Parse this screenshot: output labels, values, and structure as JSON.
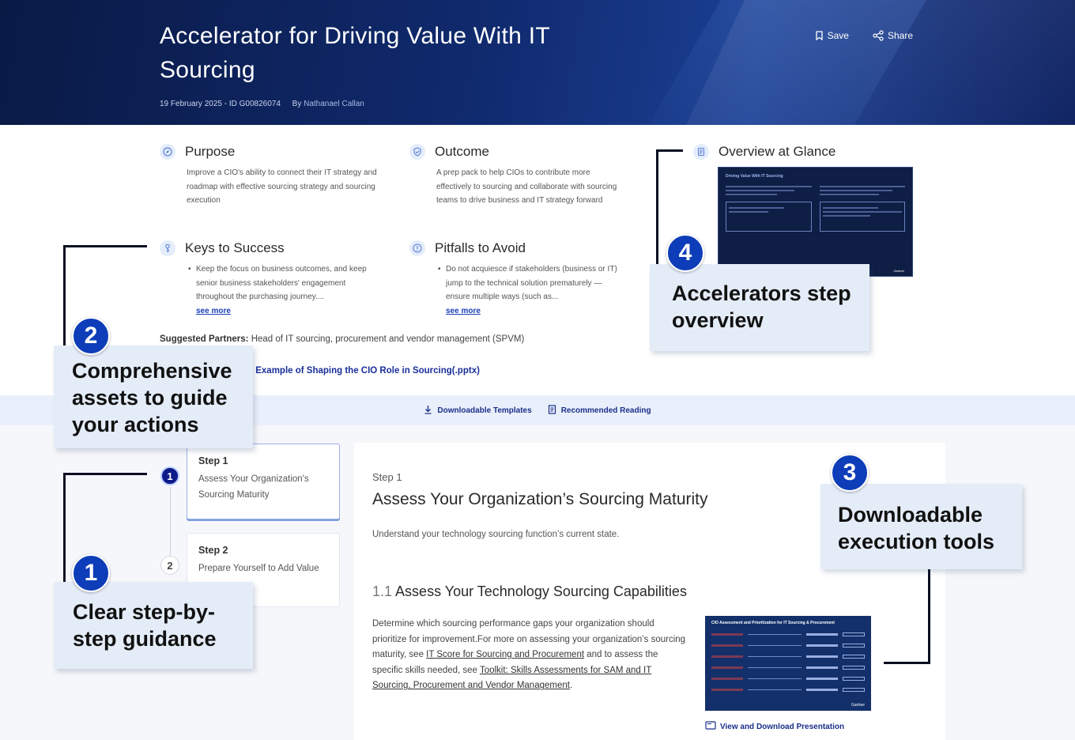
{
  "header": {
    "title": "Accelerator for Driving Value With IT Sourcing",
    "meta_date_id": "19 February 2025 - ID G00826074",
    "by_label": "By",
    "author": "Nathanael Callan",
    "save_label": "Save",
    "share_label": "Share"
  },
  "overview": {
    "purpose": {
      "title": "Purpose",
      "text": "Improve a CIO's ability to connect their IT strategy and roadmap with effective sourcing strategy and sourcing execution"
    },
    "outcome": {
      "title": "Outcome",
      "text": "A prep pack to help CIOs to contribute more effectively to sourcing and collaborate with sourcing teams to drive business and IT strategy forward"
    },
    "glance": {
      "title": "Overview at Glance",
      "thumb_title": "Driving Value With IT Sourcing",
      "thumb_brand": "Gartner"
    },
    "keys": {
      "title": "Keys to Success",
      "bullet": "Keep the focus on business outcomes, and keep senior business stakeholders' engagement throughout the purchasing journey....",
      "more": "see more"
    },
    "pitfalls": {
      "title": "Pitfalls to Avoid",
      "bullet": "Do not acquiesce if stakeholders (business or IT) jump to the technical solution prematurely — ensure multiple ways (such as...",
      "more": "see more"
    },
    "partners_label": "Suggested Partners:",
    "partners_value": "Head of IT sourcing, procurement and vendor management (SPVM)",
    "example_link": "Example of Shaping the CIO Role in Sourcing(.pptx)"
  },
  "tabs": {
    "templates": "Downloadable Templates",
    "reading": "Recommended Reading"
  },
  "steps": [
    {
      "num": "1",
      "label": "Step 1",
      "desc": "Assess Your Organization's Sourcing Maturity"
    },
    {
      "num": "2",
      "label": "Step 2",
      "desc": "Prepare Yourself to Add Value"
    }
  ],
  "content": {
    "step_label": "Step 1",
    "title": "Assess Your Organization’s Sourcing Maturity",
    "subtitle": "Understand your technology sourcing function’s current state.",
    "section_num": "1.1",
    "section_title": "Assess Your Technology Sourcing Capabilities",
    "para_1": "Determine which sourcing performance gaps your organization should prioritize for improvement.For more on assessing your organization’s sourcing maturity, see ",
    "link_1": "IT Score for Sourcing and Procurement",
    "para_2": " and to assess the specific skills needed, see ",
    "link_2": "Toolkit: Skills Assessments for SAM and IT Sourcing, Procurement and Vendor Management",
    "para_3": ".",
    "thumb_title": "CIO Assessment and Prioritization for IT Sourcing & Procurement",
    "thumb_brand": "Gartner",
    "view_link": "View and Download Presentation"
  },
  "callouts": [
    {
      "num": "1",
      "text": "Clear step-by-step guidance"
    },
    {
      "num": "2",
      "text": "Comprehensive assets to guide your actions"
    },
    {
      "num": "3",
      "text": "Downloadable execution tools"
    },
    {
      "num": "4",
      "text": "Accelerators step overview"
    }
  ]
}
